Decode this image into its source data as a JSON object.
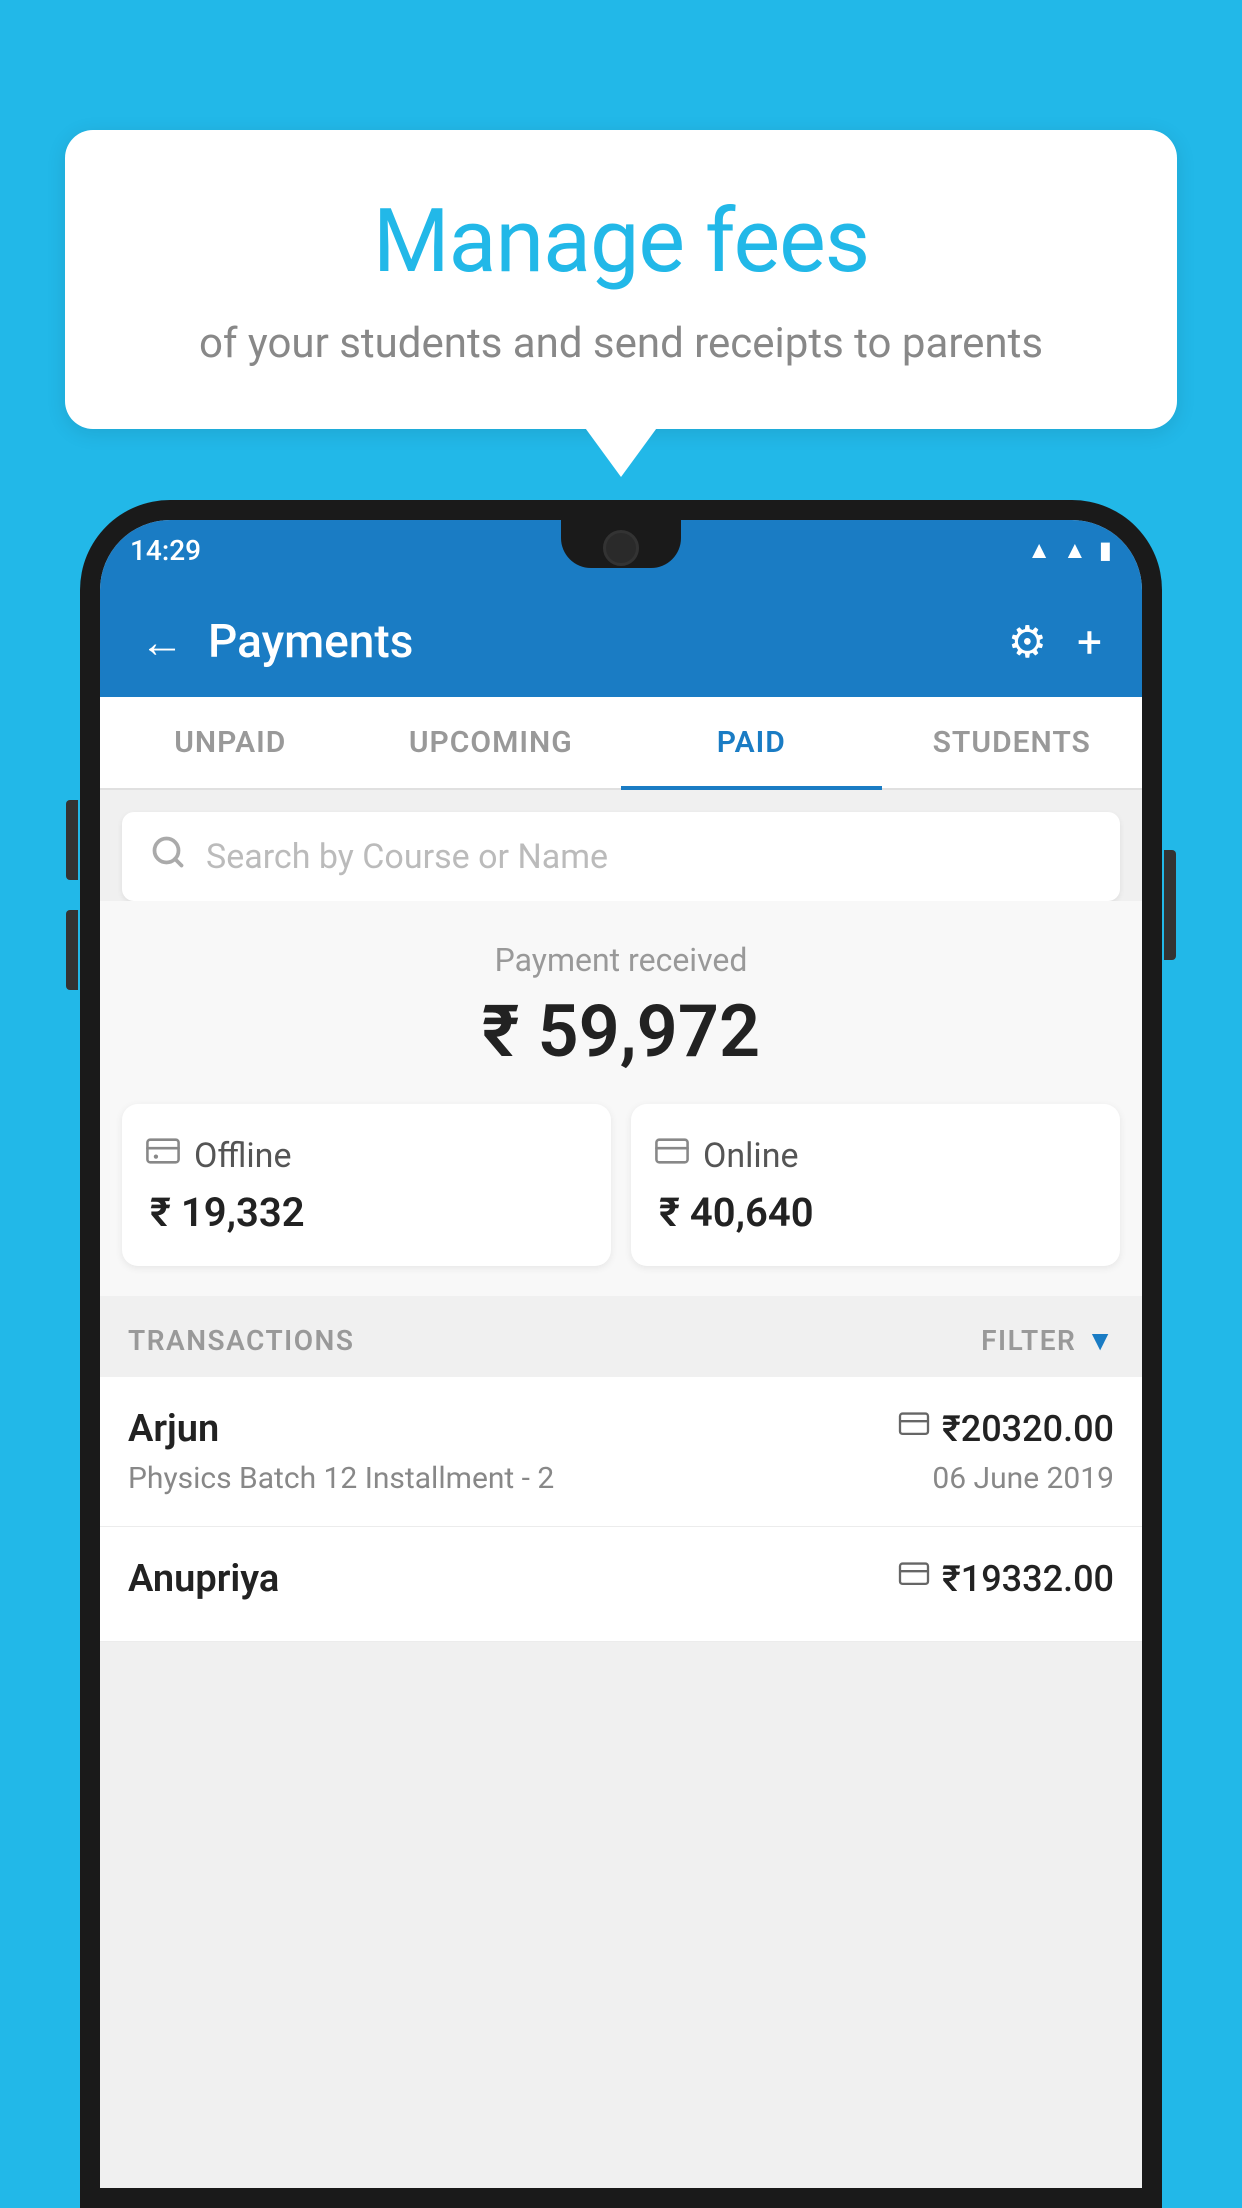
{
  "background_color": "#22b8e8",
  "speech_bubble": {
    "title": "Manage fees",
    "subtitle": "of your students and send receipts to parents"
  },
  "status_bar": {
    "time": "14:29",
    "icons": [
      "wifi",
      "signal",
      "battery"
    ]
  },
  "app_bar": {
    "title": "Payments",
    "back_label": "←",
    "settings_label": "⚙",
    "add_label": "+"
  },
  "tabs": [
    {
      "id": "unpaid",
      "label": "UNPAID",
      "active": false
    },
    {
      "id": "upcoming",
      "label": "UPCOMING",
      "active": false
    },
    {
      "id": "paid",
      "label": "PAID",
      "active": true
    },
    {
      "id": "students",
      "label": "STUDENTS",
      "active": false
    }
  ],
  "search": {
    "placeholder": "Search by Course or Name"
  },
  "payment_summary": {
    "received_label": "Payment received",
    "total_amount": "₹ 59,972",
    "offline": {
      "label": "Offline",
      "amount": "₹ 19,332"
    },
    "online": {
      "label": "Online",
      "amount": "₹ 40,640"
    }
  },
  "transactions": {
    "header_label": "TRANSACTIONS",
    "filter_label": "FILTER",
    "items": [
      {
        "name": "Arjun",
        "course": "Physics Batch 12 Installment - 2",
        "amount": "₹20320.00",
        "date": "06 June 2019",
        "payment_type": "online"
      },
      {
        "name": "Anupriya",
        "course": "",
        "amount": "₹19332.00",
        "date": "",
        "payment_type": "offline"
      }
    ]
  }
}
